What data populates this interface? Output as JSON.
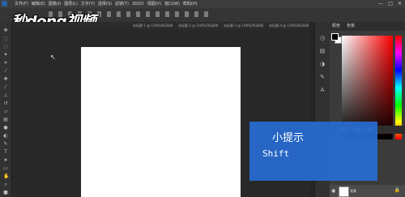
{
  "menubar": {
    "items": [
      "文件(F)",
      "编辑(E)",
      "图像(I)",
      "图层(L)",
      "文字(Y)",
      "选择(S)",
      "滤镜(T)",
      "3D(D)",
      "视图(V)",
      "窗口(W)",
      "帮助(H)"
    ],
    "controls": [
      "—",
      "□",
      "✕"
    ]
  },
  "watermark": {
    "text": "秒dong视频"
  },
  "tabs": [
    "未标题-1 @ 100%(RGB/8)",
    "未标题-2 @ 100%(RGB/8)",
    "未标题-3 @ 100%(RGB/8)",
    "未标题-4 @ 100%(RGB/8)"
  ],
  "panel": {
    "tabs": [
      "颜色",
      "色板"
    ],
    "layers_tabs": [
      "图层",
      "通道",
      "路径"
    ],
    "layer_name": "背景"
  },
  "tip": {
    "title": "小提示",
    "body": "Shift"
  },
  "colors": {
    "tip_bg": "#2f6ed0",
    "canvas": "#ffffff",
    "workspace": "#282828"
  }
}
